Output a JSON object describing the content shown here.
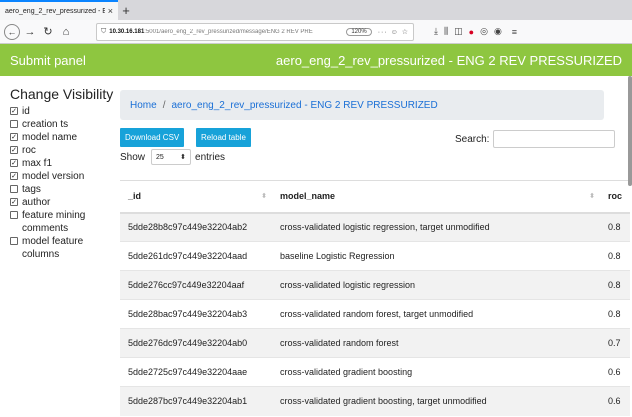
{
  "browser": {
    "tab_title": "aero_eng_2_rev_pressurized - EN",
    "tab_close": "×",
    "new_tab": "+",
    "url_host": "10.30.16.181",
    "url_path": ":5001/aero_eng_2_rev_pressurized/message/ENG 2 REV PRE",
    "zoom": "120%",
    "url_misc": "··· ☺ ☆"
  },
  "header": {
    "brand": "Submit panel",
    "title": "aero_eng_2_rev_pressurized - ENG 2 REV PRESSURIZED"
  },
  "sidebar": {
    "heading": "Change Visibility",
    "items": [
      {
        "label": "id",
        "checked": true
      },
      {
        "label": "creation ts",
        "checked": false
      },
      {
        "label": "model name",
        "checked": true
      },
      {
        "label": "roc",
        "checked": true
      },
      {
        "label": "max f1",
        "checked": true
      },
      {
        "label": "model version",
        "checked": true
      },
      {
        "label": "tags",
        "checked": false
      },
      {
        "label": "author",
        "checked": true
      },
      {
        "label": "feature mining comments",
        "checked": false
      },
      {
        "label": "model feature columns",
        "checked": false
      }
    ]
  },
  "breadcrumb": {
    "home": "Home",
    "sep": "/",
    "current": "aero_eng_2_rev_pressurized - ENG 2 REV PRESSURIZED"
  },
  "controls": {
    "download_label": "Download CSV",
    "reload_label": "Reload table",
    "show_label": "Show",
    "entries_value": "25",
    "entries_arrow": "⬍",
    "entries_label": "entries",
    "search_label": "Search:"
  },
  "table": {
    "columns": [
      "_id",
      "model_name",
      "roc"
    ],
    "rows": [
      [
        "5dde28b8c97c449e32204ab2",
        "cross-validated logistic regression, target unmodified",
        "0.8"
      ],
      [
        "5dde261dc97c449e32204aad",
        "baseline Logistic Regression",
        "0.8"
      ],
      [
        "5dde276cc97c449e32204aaf",
        "cross-validated logistic regression",
        "0.8"
      ],
      [
        "5dde28bac97c449e32204ab3",
        "cross-validated random forest, target unmodified",
        "0.8"
      ],
      [
        "5dde276dc97c449e32204ab0",
        "cross-validated random forest",
        "0.7"
      ],
      [
        "5dde2725c97c449e32204aae",
        "cross-validated gradient boosting",
        "0.6"
      ],
      [
        "5dde287bc97c449e32204ab1",
        "cross-validated gradient boosting, target unmodified",
        "0.6"
      ]
    ]
  },
  "colors": {
    "header_bg": "#8ec640",
    "button_bg": "#17a2d9",
    "link": "#1a6fd6"
  }
}
